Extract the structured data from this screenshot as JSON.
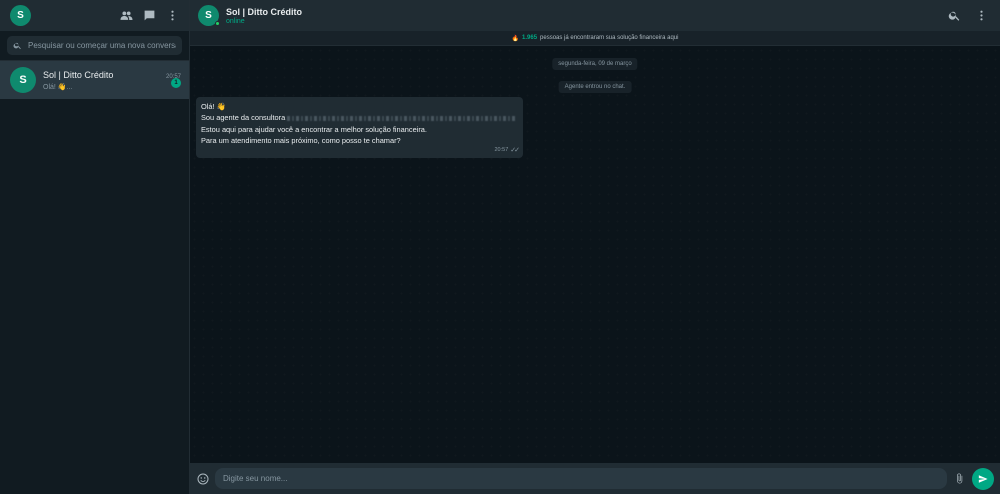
{
  "sidebar": {
    "user_avatar_letter": "S",
    "search_placeholder": "Pesquisar ou começar uma nova conversa",
    "chats": [
      {
        "avatar_letter": "S",
        "name": "Sol | Ditto Crédito",
        "time": "20:57",
        "preview": "Olá! 👋...",
        "unread": "1"
      }
    ]
  },
  "header": {
    "avatar_letter": "S",
    "name": "Sol | Ditto Crédito",
    "status": "online"
  },
  "banner": {
    "emoji": "🔥",
    "count": "1.965",
    "text": "pessoas já encontraram sua solução financeira aqui"
  },
  "messages": {
    "date_pill": "segunda-feira, 09 de março",
    "agent_pill": "Agente entrou no chat.",
    "bubble": {
      "line1": "Olá! 👋",
      "line2": "Sou agente da consultora",
      "line3": "",
      "line4": "Estou aqui para ajudar você a encontrar a melhor solução financeira.",
      "line5": "",
      "line6": "Para um atendimento mais próximo, como posso te chamar?",
      "time": "20:57",
      "ticks": "✓✓"
    }
  },
  "footer": {
    "input_placeholder": "Digite seu nome..."
  },
  "icons": {
    "community": "community-icon",
    "new_chat": "new-chat-icon",
    "menu": "menu-dots-icon",
    "search": "search-icon",
    "emoji": "emoji-icon",
    "attach": "paperclip-icon",
    "send": "send-icon"
  },
  "colors": {
    "accent": "#00a884",
    "panel": "#202c33",
    "background": "#0b141a"
  }
}
